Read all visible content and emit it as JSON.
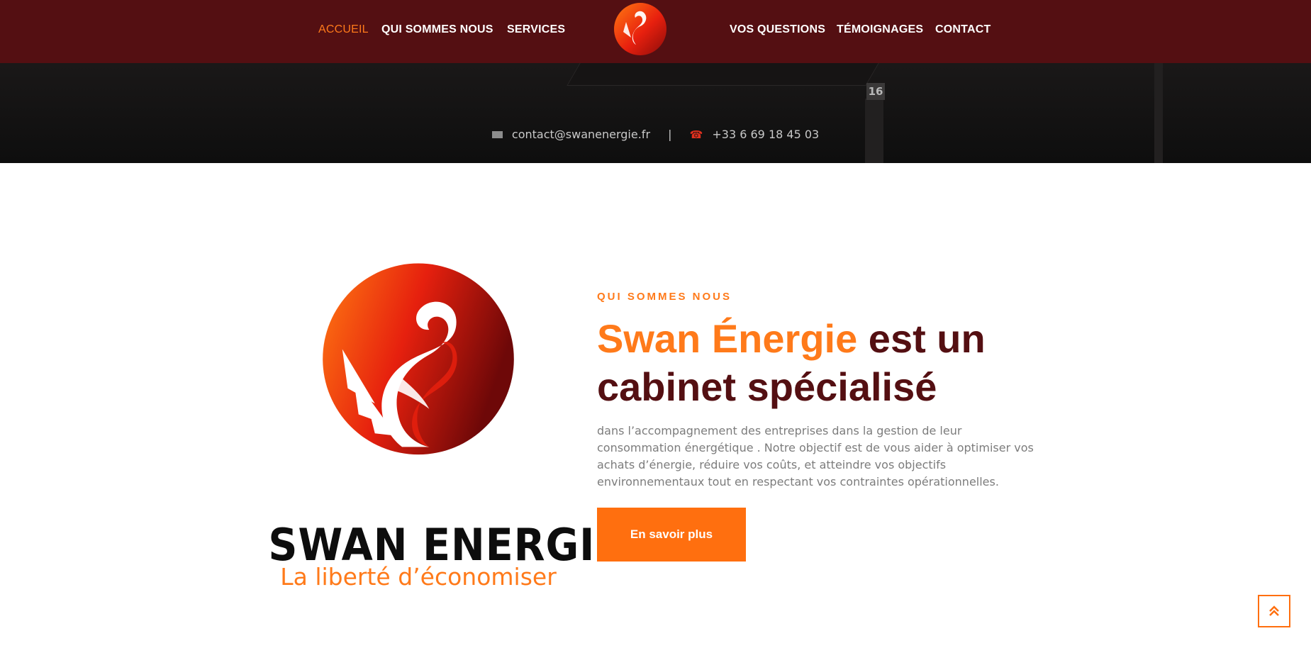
{
  "nav": {
    "items": [
      {
        "label": "ACCUEIL",
        "active": true
      },
      {
        "label": "QUI SOMMES NOUS"
      },
      {
        "label": "SERVICES"
      },
      {
        "label": "VOS QUESTIONS"
      },
      {
        "label": "TÉMOIGNAGES"
      },
      {
        "label": "CONTACT"
      }
    ]
  },
  "hero": {
    "panel_number": "16",
    "email": "contact@swanenergie.fr",
    "separator": "|",
    "phone": "+33 6 69 18 45 03"
  },
  "brand": {
    "name": "SWAN ENERGIE",
    "tagline": "La liberté d’économiser"
  },
  "about": {
    "eyebrow": "QUI SOMMES NOUS",
    "headline_accent": "Swan Énergie",
    "headline_rest": " est un cabinet spécialisé",
    "description": "dans l’accompagnement des entreprises dans la gestion de leur consommation énergétique . Notre objectif est de vous aider à optimiser vos achats d’énergie, réduire vos coûts, et atteindre vos objectifs environnementaux tout en respectant vos contraintes opérationnelles.",
    "cta_label": "En savoir plus"
  },
  "colors": {
    "brand_dark": "#540f12",
    "accent_orange": "#ff7a1a",
    "cta_orange": "#ff6f0f",
    "text_gray": "#7c7c7c"
  },
  "icons": {
    "email": "envelope-icon",
    "phone": "phone-icon",
    "scroll_top": "double-chevron-up-icon"
  }
}
